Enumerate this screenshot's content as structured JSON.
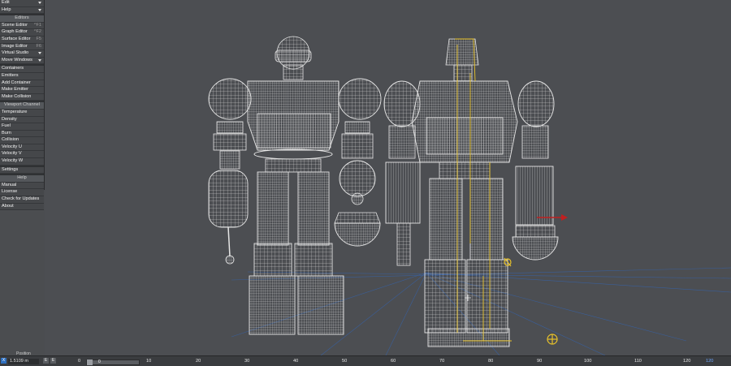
{
  "menus": [
    {
      "label": "Edit"
    },
    {
      "label": "Help"
    }
  ],
  "editors": {
    "header": "Editors",
    "items": [
      {
        "label": "Scene Editor",
        "shortcut": "^F1"
      },
      {
        "label": "Graph Editor",
        "shortcut": "^F2"
      },
      {
        "label": "Surface Editor",
        "shortcut": "F5"
      },
      {
        "label": "Image Editor",
        "shortcut": "F6"
      },
      {
        "label": "Virtual Studio",
        "shortcut": ""
      },
      {
        "label": "Move Windows",
        "shortcut": ""
      }
    ]
  },
  "containers": {
    "items": [
      {
        "label": "Containers"
      },
      {
        "label": "Emitters"
      },
      {
        "label": "Add Container"
      },
      {
        "label": "Make Emitter"
      },
      {
        "label": "Make Collision"
      }
    ]
  },
  "viewport_channel": {
    "header": "Viewport Channel",
    "items": [
      {
        "label": "Temperature"
      },
      {
        "label": "Density"
      },
      {
        "label": "Fuel"
      },
      {
        "label": "Burn"
      },
      {
        "label": "Collision"
      },
      {
        "label": "Velocity U"
      },
      {
        "label": "Velocity V"
      },
      {
        "label": "Velocity W"
      }
    ],
    "settings": "Settings"
  },
  "help_section": {
    "header": "Help",
    "items": [
      {
        "label": "Manual"
      },
      {
        "label": "License"
      },
      {
        "label": "Check for Updates"
      },
      {
        "label": "About"
      }
    ]
  },
  "bottom": {
    "position_label": "Position",
    "axis_x": "X",
    "position_value": "1.5109 m",
    "axis_buttons": [
      "E",
      "E"
    ],
    "frame_start": "0",
    "current_frame": "0",
    "frame_end": "120",
    "ticks": [
      "10",
      "20",
      "30",
      "40",
      "50",
      "60",
      "70",
      "80",
      "90",
      "100",
      "110",
      "120"
    ]
  },
  "colors": {
    "viewport_bg": "#4c4e52",
    "wire": "#e6e6e6",
    "selection": "#e8c22a",
    "grid_blue": "#3a5f9a",
    "accent_x": "#2e6fbf",
    "sidebar_bg": "#45474a"
  },
  "icons": [
    "dropdown-arrow-icon",
    "null-target-icon",
    "light-icon",
    "axis-gizmo-icon"
  ]
}
